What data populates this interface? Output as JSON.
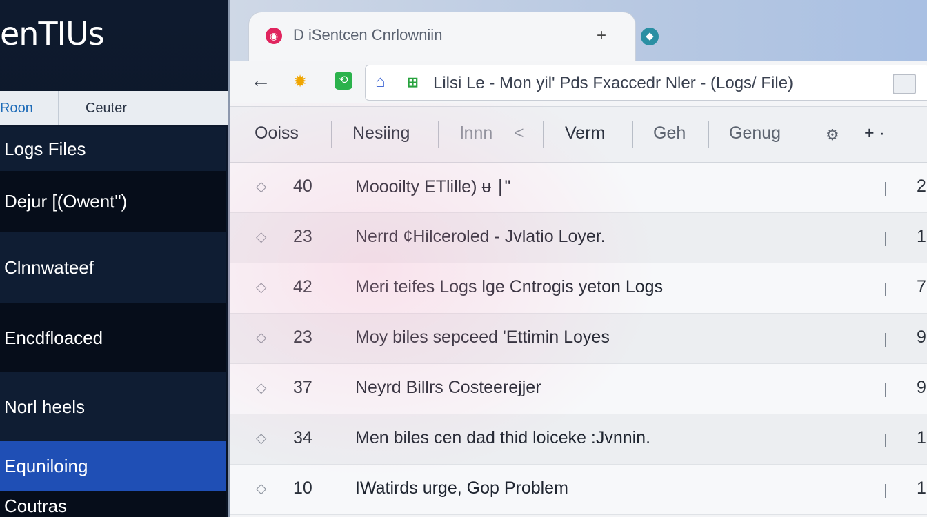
{
  "sidebar": {
    "brand": "enTIUs",
    "tabs": [
      "Roon",
      "Ceuter"
    ],
    "items": [
      {
        "label": "Logs Files"
      },
      {
        "label": "Dejur [(Owent\")"
      },
      {
        "label": "Clnnwateef"
      },
      {
        "label": "Encdfloaced"
      },
      {
        "label": "Norl heels"
      },
      {
        "label": "Equniloing"
      },
      {
        "label": "Coutras"
      }
    ]
  },
  "browser": {
    "tab": {
      "title": "D iSentcen Cnrlowniin",
      "close_glyph": "+"
    },
    "address": {
      "url": "Lilsi Le - Mon yil' Pds Fxaccedr Nler - (Logs/ File)"
    },
    "columns": [
      "Ooiss",
      "Nesiing",
      "lnnn",
      "<",
      "Verm",
      "Geh",
      "Genug",
      "+ ·"
    ],
    "rows": [
      {
        "num": "40",
        "text": "Moooilty ETlille)   ᵾ ∣\"",
        "end": "2"
      },
      {
        "num": "23",
        "text": "Nerrd ¢Hilceroled - Jvlatio Loyer.",
        "end": "1"
      },
      {
        "num": "42",
        "text": "Meri teifes Logs lge Cntrogis yeton Logs",
        "end": "7"
      },
      {
        "num": "23",
        "text": "Moy biles sepceed 'Ettimin Loyes",
        "end": "9"
      },
      {
        "num": "37",
        "text": "Neyrd Billrs Costeerejjer",
        "end": "9"
      },
      {
        "num": "34",
        "text": "Men biles cen dad thid loiceke :Jvnnin.",
        "end": "1"
      },
      {
        "num": "10",
        "text": "IWatirds urge, Gop Problem",
        "end": "1"
      }
    ]
  }
}
